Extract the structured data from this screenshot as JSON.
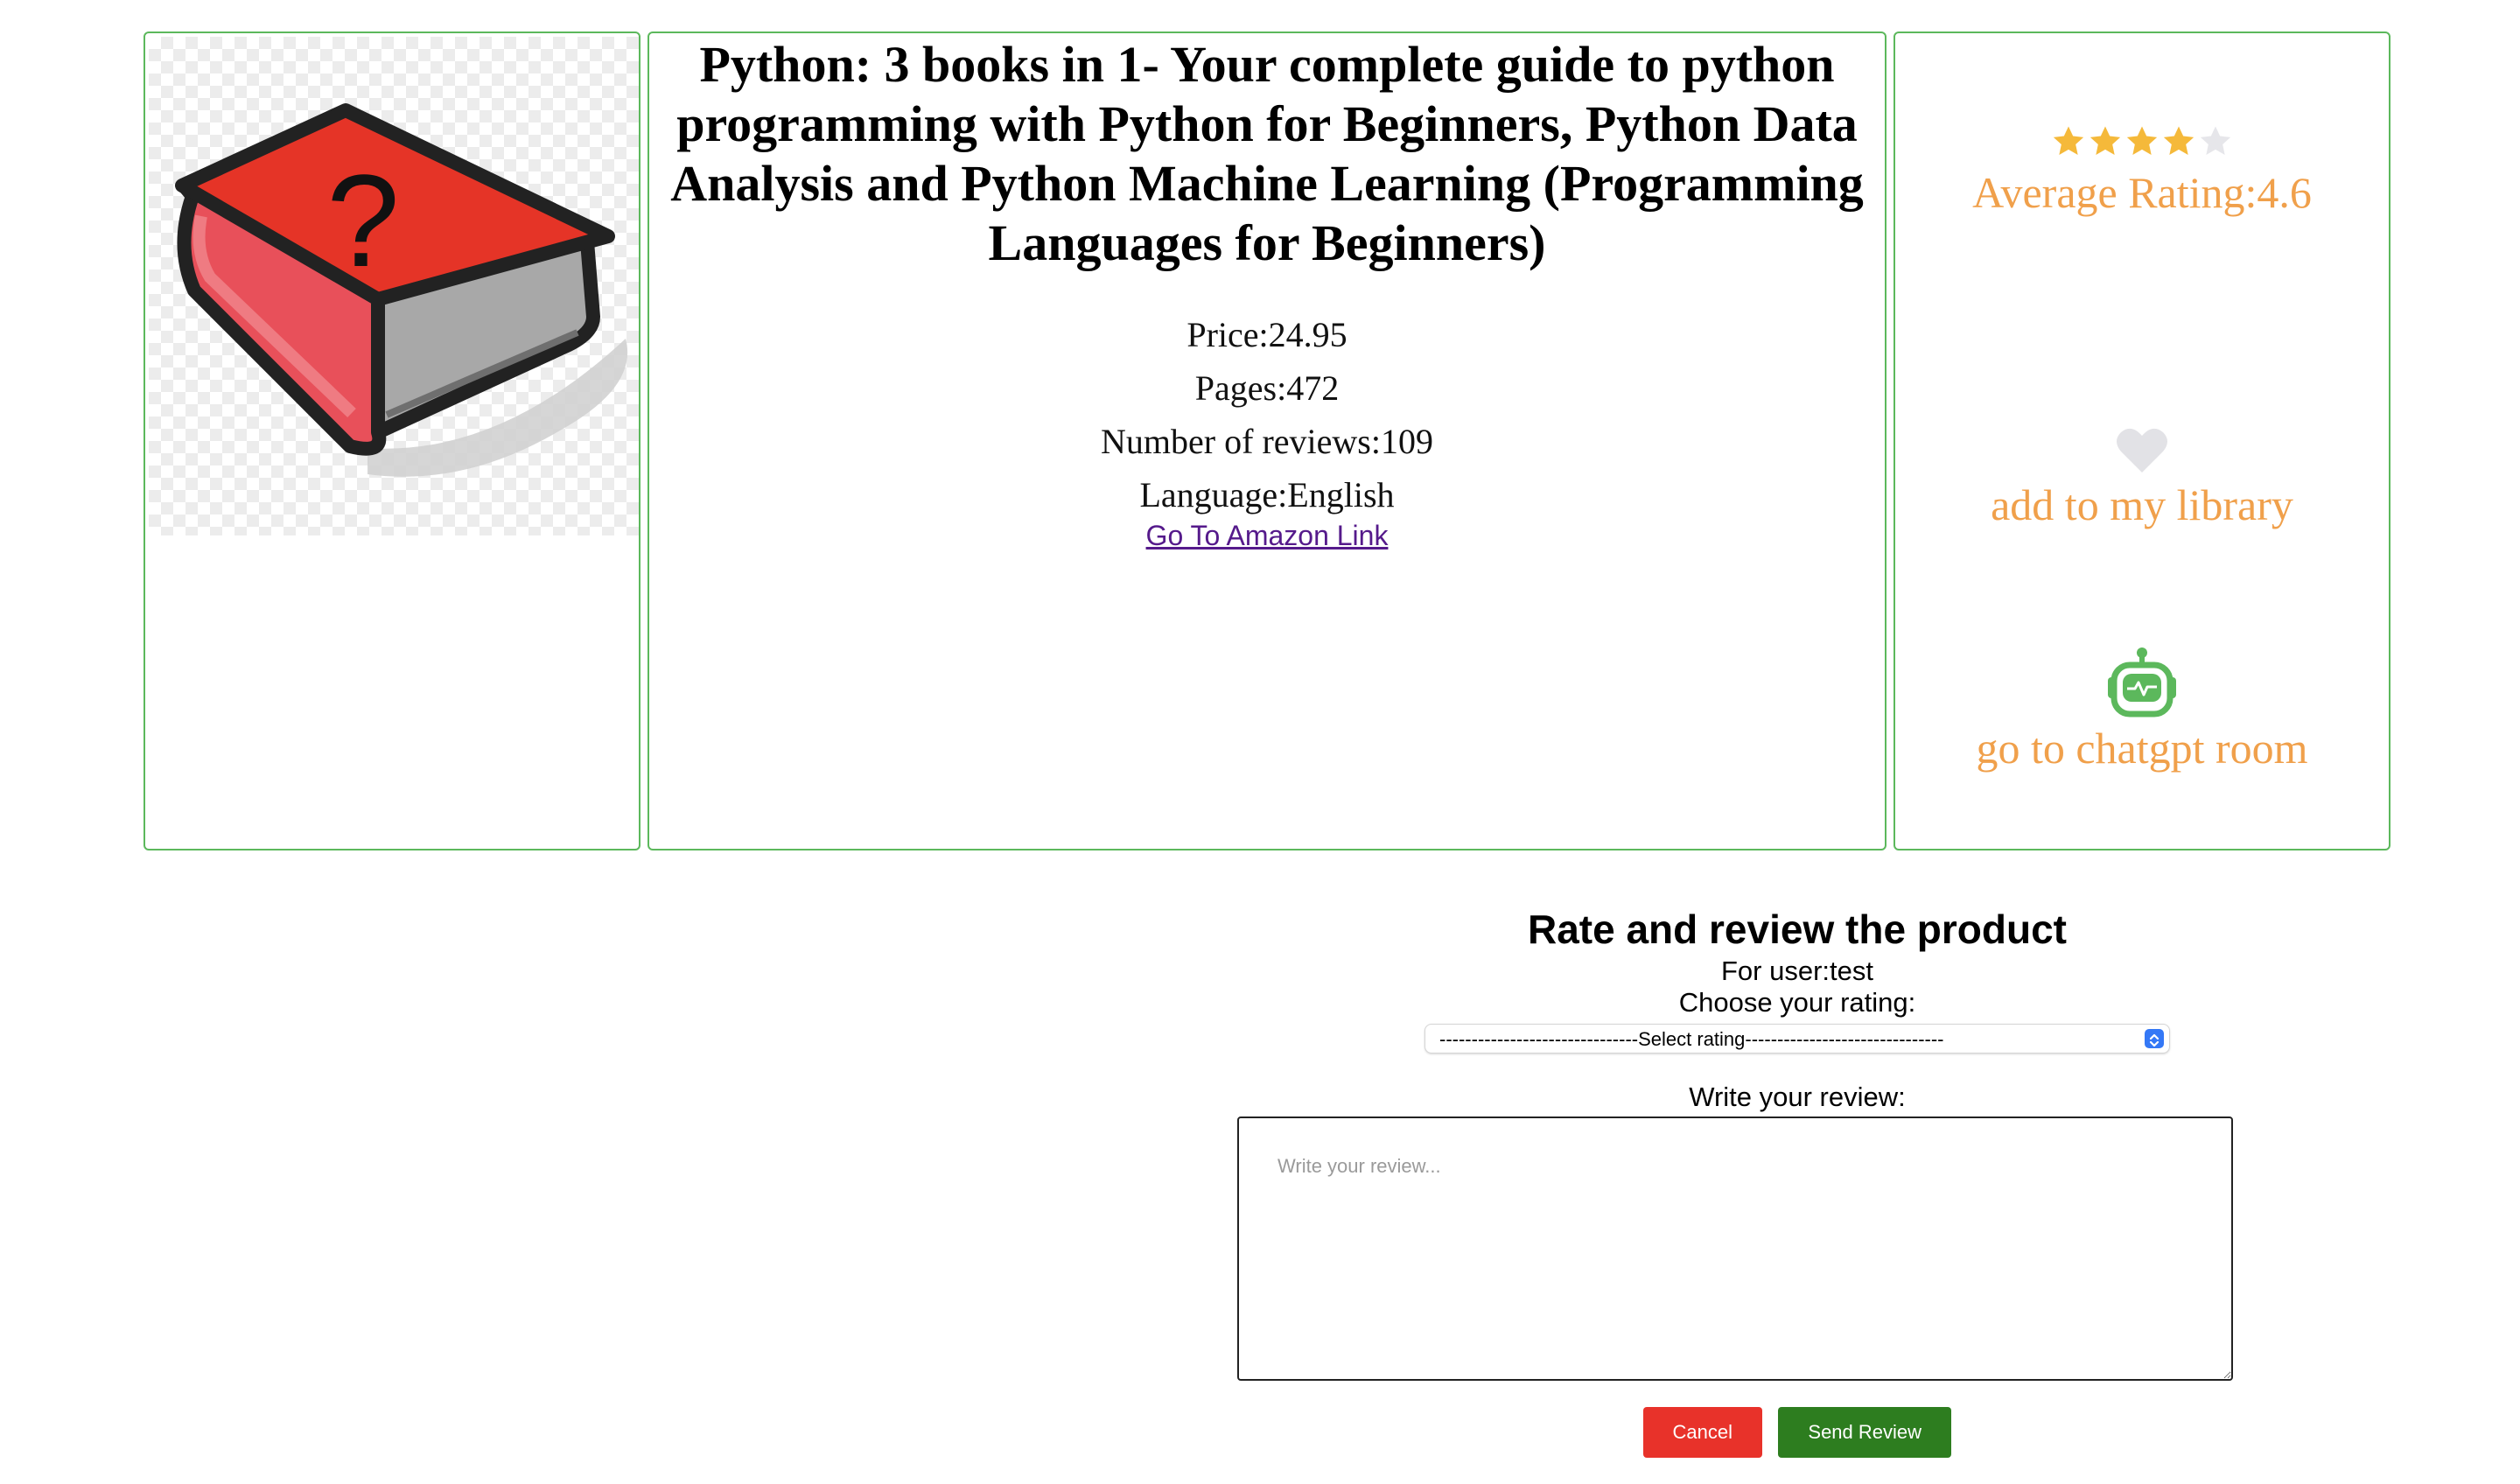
{
  "book": {
    "title": "Python: 3 books in 1- Your complete guide to python programming with Python for Beginners, Python Data Analysis and Python Machine Learning (Programming Languages for Beginners)",
    "cover_icon": "book-question-mark-icon",
    "price": "Price:24.95",
    "pages": "Pages:472",
    "reviews_count": "Number of reviews:109",
    "language": "Language:English",
    "amazon_link": "Go To Amazon Link"
  },
  "actions": {
    "stars_filled": 4,
    "stars_total": 5,
    "average_rating": "Average Rating:4.6",
    "add_library": "add to my library",
    "chatgpt_room": "go to chatgpt room"
  },
  "review": {
    "heading": "Rate and review the product",
    "user_line": "For user:test",
    "choose_rating": "Choose your rating:",
    "select_value": "-------------------------------Select rating-------------------------------",
    "write_review": "Write your review:",
    "placeholder": "Write your review...",
    "cancel": "Cancel",
    "send": "Send Review"
  },
  "colors": {
    "panel_border": "#5cb85c",
    "accent_text": "#f0a04b",
    "star_filled": "#f5b93a",
    "star_empty": "#e6e6ea",
    "heart": "#e2e2e6",
    "robot": "#5cb85c",
    "cancel_button": "#e8322a",
    "send_button": "#2d7d1f"
  }
}
